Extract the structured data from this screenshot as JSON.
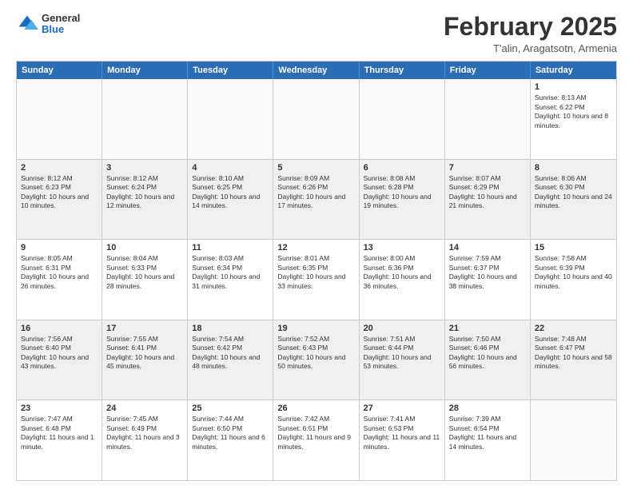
{
  "header": {
    "logo_general": "General",
    "logo_blue": "Blue",
    "month_year": "February 2025",
    "location": "T'alin, Aragatsotn, Armenia"
  },
  "days_of_week": [
    "Sunday",
    "Monday",
    "Tuesday",
    "Wednesday",
    "Thursday",
    "Friday",
    "Saturday"
  ],
  "weeks": [
    [
      {
        "day": "",
        "text": "",
        "empty": true
      },
      {
        "day": "",
        "text": "",
        "empty": true
      },
      {
        "day": "",
        "text": "",
        "empty": true
      },
      {
        "day": "",
        "text": "",
        "empty": true
      },
      {
        "day": "",
        "text": "",
        "empty": true
      },
      {
        "day": "",
        "text": "",
        "empty": true
      },
      {
        "day": "1",
        "text": "Sunrise: 8:13 AM\nSunset: 6:22 PM\nDaylight: 10 hours and 8 minutes."
      }
    ],
    [
      {
        "day": "2",
        "text": "Sunrise: 8:12 AM\nSunset: 6:23 PM\nDaylight: 10 hours and 10 minutes."
      },
      {
        "day": "3",
        "text": "Sunrise: 8:12 AM\nSunset: 6:24 PM\nDaylight: 10 hours and 12 minutes."
      },
      {
        "day": "4",
        "text": "Sunrise: 8:10 AM\nSunset: 6:25 PM\nDaylight: 10 hours and 14 minutes."
      },
      {
        "day": "5",
        "text": "Sunrise: 8:09 AM\nSunset: 6:26 PM\nDaylight: 10 hours and 17 minutes."
      },
      {
        "day": "6",
        "text": "Sunrise: 8:08 AM\nSunset: 6:28 PM\nDaylight: 10 hours and 19 minutes."
      },
      {
        "day": "7",
        "text": "Sunrise: 8:07 AM\nSunset: 6:29 PM\nDaylight: 10 hours and 21 minutes."
      },
      {
        "day": "8",
        "text": "Sunrise: 8:06 AM\nSunset: 6:30 PM\nDaylight: 10 hours and 24 minutes."
      }
    ],
    [
      {
        "day": "9",
        "text": "Sunrise: 8:05 AM\nSunset: 6:31 PM\nDaylight: 10 hours and 26 minutes."
      },
      {
        "day": "10",
        "text": "Sunrise: 8:04 AM\nSunset: 6:33 PM\nDaylight: 10 hours and 28 minutes."
      },
      {
        "day": "11",
        "text": "Sunrise: 8:03 AM\nSunset: 6:34 PM\nDaylight: 10 hours and 31 minutes."
      },
      {
        "day": "12",
        "text": "Sunrise: 8:01 AM\nSunset: 6:35 PM\nDaylight: 10 hours and 33 minutes."
      },
      {
        "day": "13",
        "text": "Sunrise: 8:00 AM\nSunset: 6:36 PM\nDaylight: 10 hours and 36 minutes."
      },
      {
        "day": "14",
        "text": "Sunrise: 7:59 AM\nSunset: 6:37 PM\nDaylight: 10 hours and 38 minutes."
      },
      {
        "day": "15",
        "text": "Sunrise: 7:58 AM\nSunset: 6:39 PM\nDaylight: 10 hours and 40 minutes."
      }
    ],
    [
      {
        "day": "16",
        "text": "Sunrise: 7:56 AM\nSunset: 6:40 PM\nDaylight: 10 hours and 43 minutes."
      },
      {
        "day": "17",
        "text": "Sunrise: 7:55 AM\nSunset: 6:41 PM\nDaylight: 10 hours and 45 minutes."
      },
      {
        "day": "18",
        "text": "Sunrise: 7:54 AM\nSunset: 6:42 PM\nDaylight: 10 hours and 48 minutes."
      },
      {
        "day": "19",
        "text": "Sunrise: 7:52 AM\nSunset: 6:43 PM\nDaylight: 10 hours and 50 minutes."
      },
      {
        "day": "20",
        "text": "Sunrise: 7:51 AM\nSunset: 6:44 PM\nDaylight: 10 hours and 53 minutes."
      },
      {
        "day": "21",
        "text": "Sunrise: 7:50 AM\nSunset: 6:46 PM\nDaylight: 10 hours and 56 minutes."
      },
      {
        "day": "22",
        "text": "Sunrise: 7:48 AM\nSunset: 6:47 PM\nDaylight: 10 hours and 58 minutes."
      }
    ],
    [
      {
        "day": "23",
        "text": "Sunrise: 7:47 AM\nSunset: 6:48 PM\nDaylight: 11 hours and 1 minute."
      },
      {
        "day": "24",
        "text": "Sunrise: 7:45 AM\nSunset: 6:49 PM\nDaylight: 11 hours and 3 minutes."
      },
      {
        "day": "25",
        "text": "Sunrise: 7:44 AM\nSunset: 6:50 PM\nDaylight: 11 hours and 6 minutes."
      },
      {
        "day": "26",
        "text": "Sunrise: 7:42 AM\nSunset: 6:51 PM\nDaylight: 11 hours and 9 minutes."
      },
      {
        "day": "27",
        "text": "Sunrise: 7:41 AM\nSunset: 6:53 PM\nDaylight: 11 hours and 11 minutes."
      },
      {
        "day": "28",
        "text": "Sunrise: 7:39 AM\nSunset: 6:54 PM\nDaylight: 11 hours and 14 minutes."
      },
      {
        "day": "",
        "text": "",
        "empty": true
      }
    ]
  ]
}
